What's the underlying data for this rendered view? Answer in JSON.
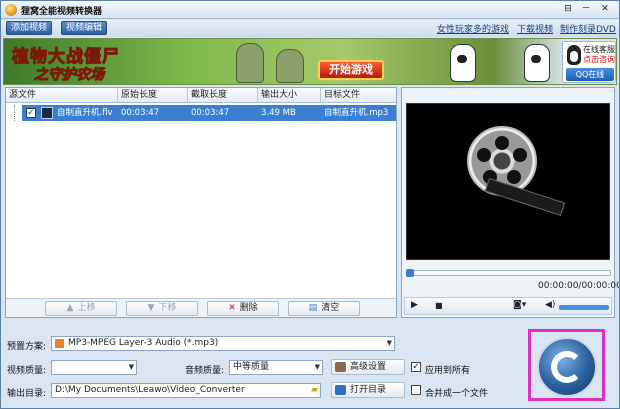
{
  "window": {
    "title": "狸窝全能视频转换器",
    "controls": [
      "⊟",
      "－",
      "✕"
    ]
  },
  "menu": {
    "add_video": "添加视频",
    "video_edit": "视频编辑"
  },
  "top_links": [
    "女性玩家多的游戏",
    "下载视频",
    "制作刻录DVD"
  ],
  "banner": {
    "title": "植物大战僵尸",
    "subtitle": "之守护农场",
    "play_button": "开始游戏",
    "support_line1": "在线客服",
    "support_line2": "点击咨询",
    "support_qq": "QQ在线"
  },
  "file_table": {
    "columns": [
      "源文件",
      "原始长度",
      "截取长度",
      "输出大小",
      "目标文件"
    ],
    "rows": [
      {
        "checked": "✓",
        "source": "自制直升机.flv",
        "original_length": "00:03:47",
        "clip_length": "00:03:47",
        "output_size": "3.49 MB",
        "target": "自制直升机.mp3"
      }
    ]
  },
  "actions": {
    "move_up": "上移",
    "move_down": "下移",
    "delete": "删除",
    "clear": "清空"
  },
  "player": {
    "timecode": "00:00:00/00:00:00",
    "volume": 1.0
  },
  "settings": {
    "preset_label": "预置方案:",
    "preset_value": "MP3-MPEG Layer-3 Audio (*.mp3)",
    "video_quality_label": "视频质量:",
    "video_quality_value": "",
    "audio_quality_label": "音频质量:",
    "audio_quality_value": "中等质量",
    "advanced_button": "高级设置",
    "apply_all_label": "应用到所有",
    "apply_all_checked": "✓",
    "output_dir_label": "输出目录:",
    "output_dir_value": "D:\\My Documents\\Leawo\\Video_Converter",
    "open_dir_button": "打开目录",
    "merge_label": "合并成一个文件",
    "merge_checked": ""
  },
  "colors": {
    "accent": "#3a7fd0",
    "highlight_frame": "#e030c0"
  }
}
